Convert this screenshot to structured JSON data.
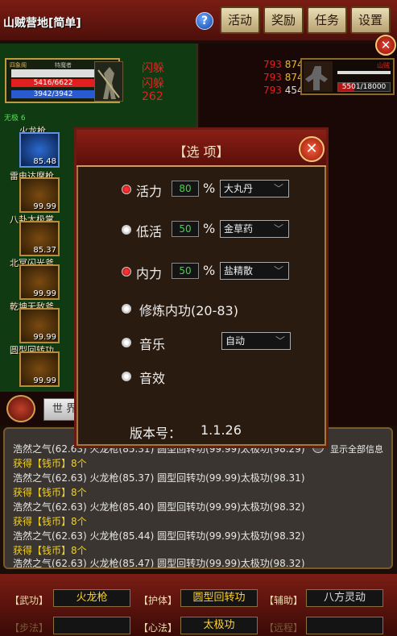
{
  "header": {
    "title": "山贼营地[简单]",
    "help": "?",
    "buttons": [
      "活动",
      "奖励",
      "任务",
      "设置"
    ]
  },
  "player": {
    "name": "四象阁",
    "tag": "特魔者",
    "hp": "5416/6622",
    "mp": "3942/3942",
    "hp_fraction": 0.82
  },
  "combat_text": [
    "闪躲",
    "闪躲",
    "262"
  ],
  "skill_tier": "无极 6",
  "skills": [
    {
      "name": "火龙枪",
      "value": "85.48"
    },
    {
      "name": "雷电达摩枪",
      "value": "99.99"
    },
    {
      "name": "八卦太极掌",
      "value": "85.37"
    },
    {
      "name": "北冥闪光斧",
      "value": "99.99"
    },
    {
      "name": "乾坤无敌斧",
      "value": "99.99"
    },
    {
      "name": "圆型回转功",
      "value": "99.99"
    }
  ],
  "damage_numbers": [
    [
      "793",
      "874"
    ],
    [
      "793",
      "874"
    ],
    [
      "793",
      "454"
    ]
  ],
  "enemy": {
    "name": "山贼",
    "hp": "5501/18000",
    "hp_fraction": 0.31
  },
  "dialog": {
    "title": "【选  项】",
    "options": [
      {
        "label": "活力",
        "value": "80",
        "unit": "%",
        "item": "大丸丹",
        "checked": true
      },
      {
        "label": "低活",
        "value": "50",
        "unit": "%",
        "item": "金草药",
        "checked": false
      },
      {
        "label": "内力",
        "value": "50",
        "unit": "%",
        "item": "盐精散",
        "checked": true
      }
    ],
    "cultivate": "修炼内功(20-83)",
    "music": "音乐",
    "music_mode": "自动",
    "sfx": "音效",
    "version_label": "版本号：",
    "version": "1.1.26"
  },
  "chat": {
    "tab": "世 界",
    "show_all": "显示全部信息",
    "lines": [
      {
        "t": "浩然之气(62.63) 火龙枪(85.31) 圆型回转功(99.99)太极功(98.29)",
        "c": "w"
      },
      {
        "t": "获得【钱币】8个",
        "c": "y"
      },
      {
        "t": "浩然之气(62.63) 火龙枪(85.37) 圆型回转功(99.99)太极功(98.31)",
        "c": "w"
      },
      {
        "t": "获得【钱币】8个",
        "c": "y"
      },
      {
        "t": "浩然之气(62.63) 火龙枪(85.40) 圆型回转功(99.99)太极功(98.32)",
        "c": "w"
      },
      {
        "t": "获得【钱币】8个",
        "c": "y"
      },
      {
        "t": "浩然之气(62.63) 火龙枪(85.44) 圆型回转功(99.99)太极功(98.32)",
        "c": "w"
      },
      {
        "t": "获得【钱币】8个",
        "c": "y"
      },
      {
        "t": "浩然之气(62.63) 火龙枪(85.47) 圆型回转功(99.99)太极功(98.32)",
        "c": "w"
      }
    ]
  },
  "equip": [
    {
      "label": "【武功】",
      "value": "火龙枪"
    },
    {
      "label": "【护体】",
      "value": "圆型回转功"
    },
    {
      "label": "【辅助】",
      "value": "八方灵动"
    },
    {
      "label": "【步法】",
      "value": ""
    },
    {
      "label": "【心法】",
      "value": "太极功"
    },
    {
      "label": "【远程】",
      "value": ""
    }
  ],
  "colors": {
    "accent": "#7a1d14",
    "gold": "#c8a060",
    "hp": "#e02020",
    "mp": "#2a5ad0"
  }
}
